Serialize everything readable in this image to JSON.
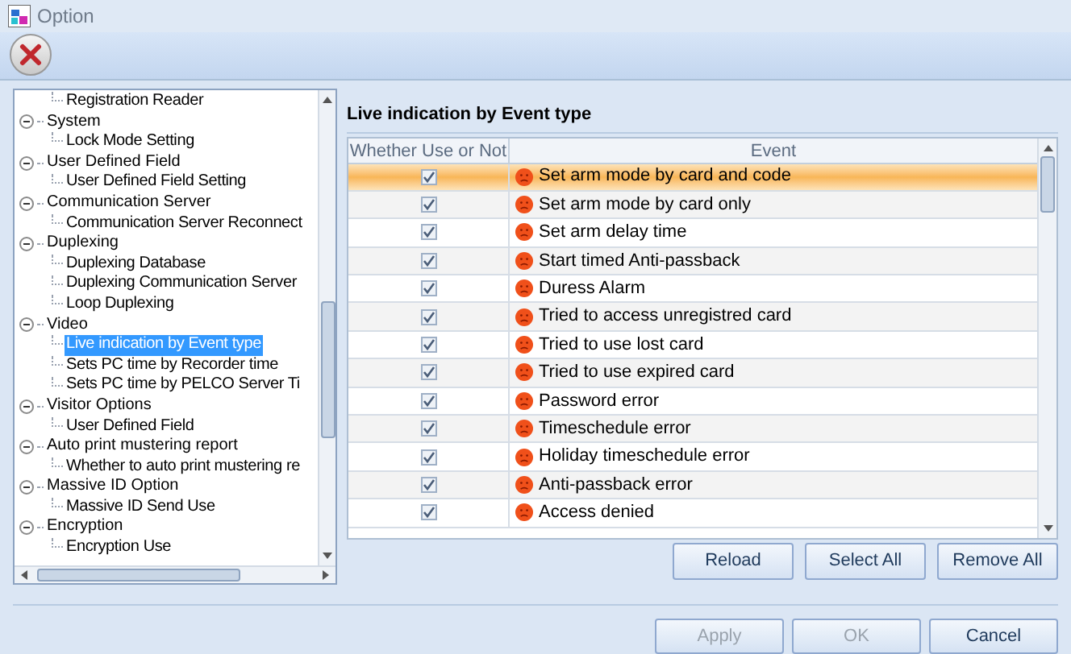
{
  "window": {
    "title": "Option"
  },
  "tree": {
    "continued_children": [
      {
        "label": "Registration Reader",
        "selected": false
      }
    ],
    "items": [
      {
        "label": "System",
        "expanded": true,
        "children": [
          {
            "label": "Lock Mode Setting",
            "selected": false
          }
        ]
      },
      {
        "label": "User Defined Field",
        "expanded": true,
        "children": [
          {
            "label": "User Defined Field Setting",
            "selected": false
          }
        ]
      },
      {
        "label": "Communication Server",
        "expanded": true,
        "children": [
          {
            "label": "Communication Server Reconnect",
            "selected": false
          }
        ]
      },
      {
        "label": "Duplexing",
        "expanded": true,
        "children": [
          {
            "label": "Duplexing Database",
            "selected": false
          },
          {
            "label": "Duplexing Communication Server",
            "selected": false
          },
          {
            "label": "Loop Duplexing",
            "selected": false
          }
        ]
      },
      {
        "label": "Video",
        "expanded": true,
        "children": [
          {
            "label": "Live indication by Event type",
            "selected": true
          },
          {
            "label": "Sets PC time by Recorder time",
            "selected": false
          },
          {
            "label": "Sets PC time by PELCO Server Ti",
            "selected": false
          }
        ]
      },
      {
        "label": "Visitor Options",
        "expanded": true,
        "children": [
          {
            "label": "User Defined Field",
            "selected": false
          }
        ]
      },
      {
        "label": "Auto print mustering report",
        "expanded": true,
        "children": [
          {
            "label": "Whether to auto print mustering re",
            "selected": false
          }
        ]
      },
      {
        "label": "Massive ID Option",
        "expanded": true,
        "children": [
          {
            "label": "Massive ID Send Use",
            "selected": false
          }
        ]
      },
      {
        "label": "Encryption",
        "expanded": true,
        "children": [
          {
            "label": "Encryption Use",
            "selected": false
          }
        ]
      }
    ]
  },
  "section_title": "Live indication by Event type",
  "table": {
    "columns": [
      "Whether Use or Not",
      "Event"
    ],
    "rows": [
      {
        "checked": true,
        "event": "Set arm mode by card and code",
        "selected": true
      },
      {
        "checked": true,
        "event": "Set arm mode by card only",
        "selected": false
      },
      {
        "checked": true,
        "event": "Set arm delay time",
        "selected": false
      },
      {
        "checked": true,
        "event": "Start timed Anti-passback",
        "selected": false
      },
      {
        "checked": true,
        "event": "Duress Alarm",
        "selected": false
      },
      {
        "checked": true,
        "event": "Tried to access unregistred card",
        "selected": false
      },
      {
        "checked": true,
        "event": "Tried to use lost card",
        "selected": false
      },
      {
        "checked": true,
        "event": "Tried to use expired card",
        "selected": false
      },
      {
        "checked": true,
        "event": "Password error",
        "selected": false
      },
      {
        "checked": true,
        "event": "Timeschedule error",
        "selected": false
      },
      {
        "checked": true,
        "event": "Holiday timeschedule error",
        "selected": false
      },
      {
        "checked": true,
        "event": "Anti-passback error",
        "selected": false
      },
      {
        "checked": true,
        "event": "Access denied",
        "selected": false
      }
    ]
  },
  "table_buttons": [
    "Reload",
    "Select All",
    "Remove All"
  ],
  "dialog_buttons": [
    {
      "label": "Apply",
      "disabled": true
    },
    {
      "label": "OK",
      "disabled": true
    },
    {
      "label": "Cancel",
      "disabled": false
    }
  ]
}
